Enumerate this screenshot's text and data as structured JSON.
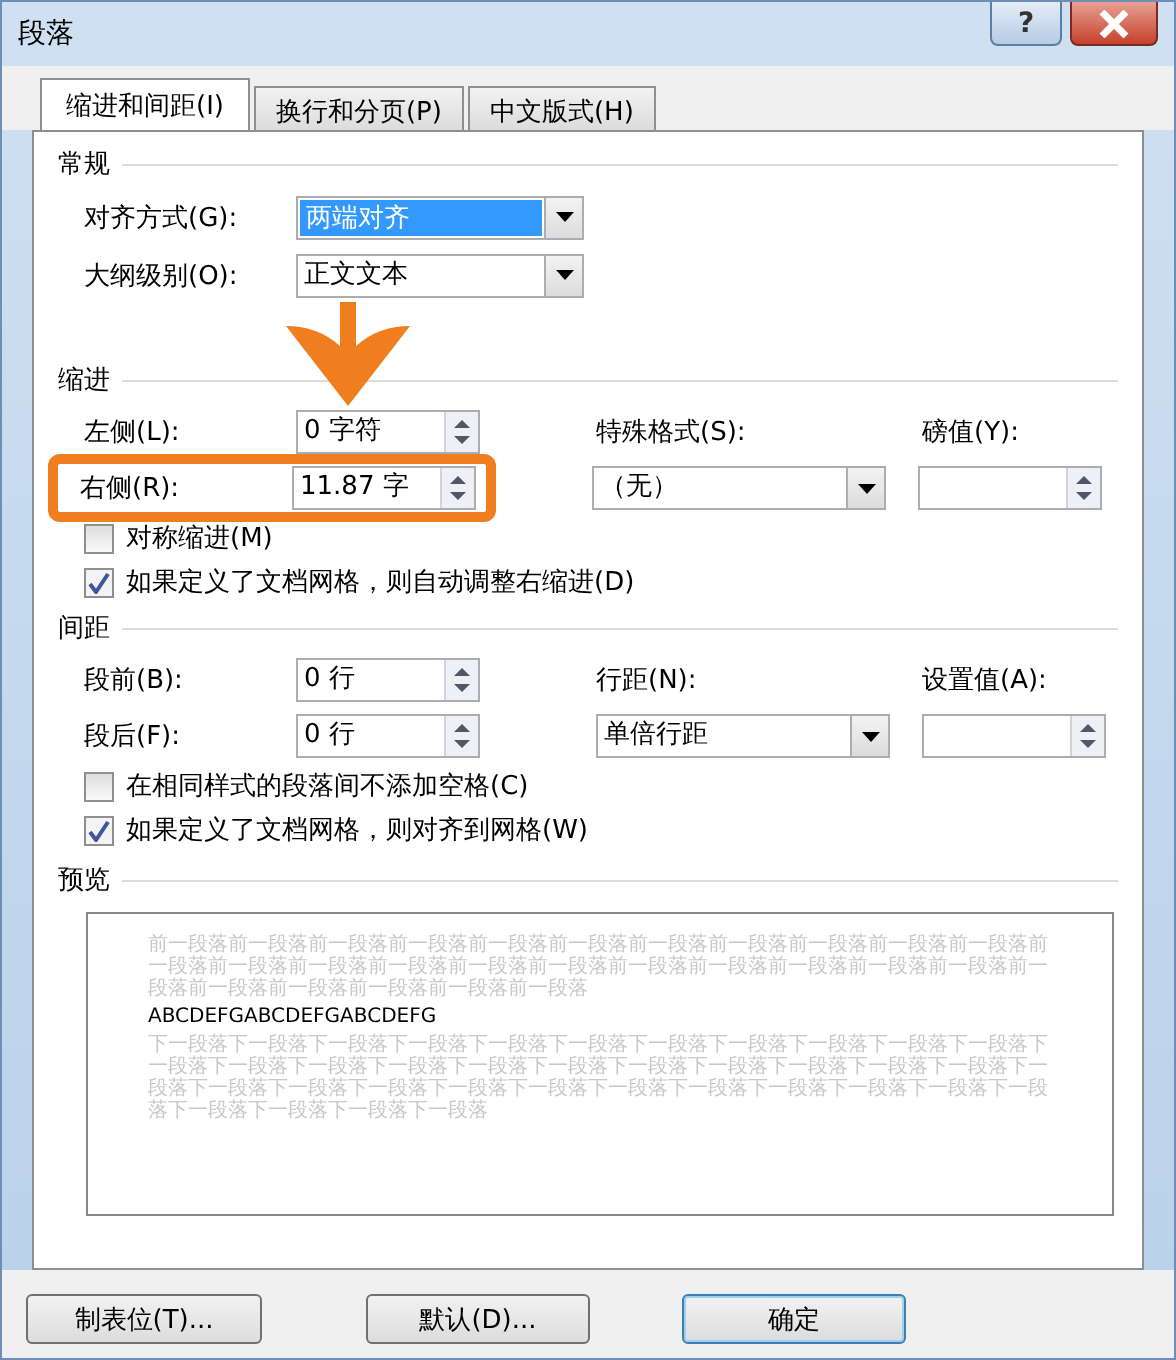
{
  "window": {
    "title": "段落",
    "help_label": "?"
  },
  "tabs": [
    {
      "label": "缩进和间距(I)",
      "selected": true
    },
    {
      "label": "换行和分页(P)",
      "selected": false
    },
    {
      "label": "中文版式(H)",
      "selected": false
    }
  ],
  "general": {
    "heading": "常规",
    "fields": [
      {
        "label": "对齐方式(G):",
        "value": "两端对齐",
        "highlighted": true
      },
      {
        "label": "大纲级别(O):",
        "value": "正文文本",
        "highlighted": false
      }
    ]
  },
  "indentation": {
    "heading": "缩进",
    "left": {
      "label": "左侧(L):",
      "value": "0 字符",
      "annotated": false
    },
    "right": {
      "label": "右侧(R):",
      "value": "11.87 字",
      "annotated": true
    },
    "special": {
      "label": "特殊格式(S):",
      "value": "（无）"
    },
    "by": {
      "label": "磅值(Y):"
    },
    "checkboxes": [
      {
        "label": "对称缩进(M)",
        "checked": false
      },
      {
        "label": "如果定义了文档网格，则自动调整右缩进(D)",
        "checked": true
      }
    ]
  },
  "spacing": {
    "heading": "间距",
    "before": {
      "label": "段前(B):",
      "value": "0 行"
    },
    "after": {
      "label": "段后(F):",
      "value": "0 行"
    },
    "line": {
      "label": "行距(N):",
      "value": "单倍行距"
    },
    "at": {
      "label": "设置值(A):"
    },
    "checkboxes": [
      {
        "label": "在相同样式的段落间不添加空格(C)",
        "checked": false
      },
      {
        "label": "如果定义了文档网格，则对齐到网格(W)",
        "checked": true
      }
    ]
  },
  "preview": {
    "heading": "预览",
    "before_text": "前一段落前一段落前一段落前一段落前一段落前一段落前一段落前一段落前一段落前一段落前一段落前一段落前一段落前一段落前一段落前一段落前一段落前一段落前一段落前一段落前一段落前一段落前一段落前一段落前一段落前一段落前一段落前一段落",
    "sample": "ABCDEFGABCDEFGABCDEFG",
    "after_text": "下一段落下一段落下一段落下一段落下一段落下一段落下一段落下一段落下一段落下一段落下一段落下一段落下一段落下一段落下一段落下一段落下一段落下一段落下一段落下一段落下一段落下一段落下一段落下一段落下一段落下一段落下一段落下一段落下一段落下一段落下一段落下一段落下一段落下一段落下一段落下一段落下一段落下一段落"
  },
  "annotation_arrow": true,
  "buttons": [
    {
      "label": "制表位(T)...",
      "default": false
    },
    {
      "label": "默认(D)...",
      "default": false
    },
    {
      "label": "确定",
      "default": true
    }
  ]
}
